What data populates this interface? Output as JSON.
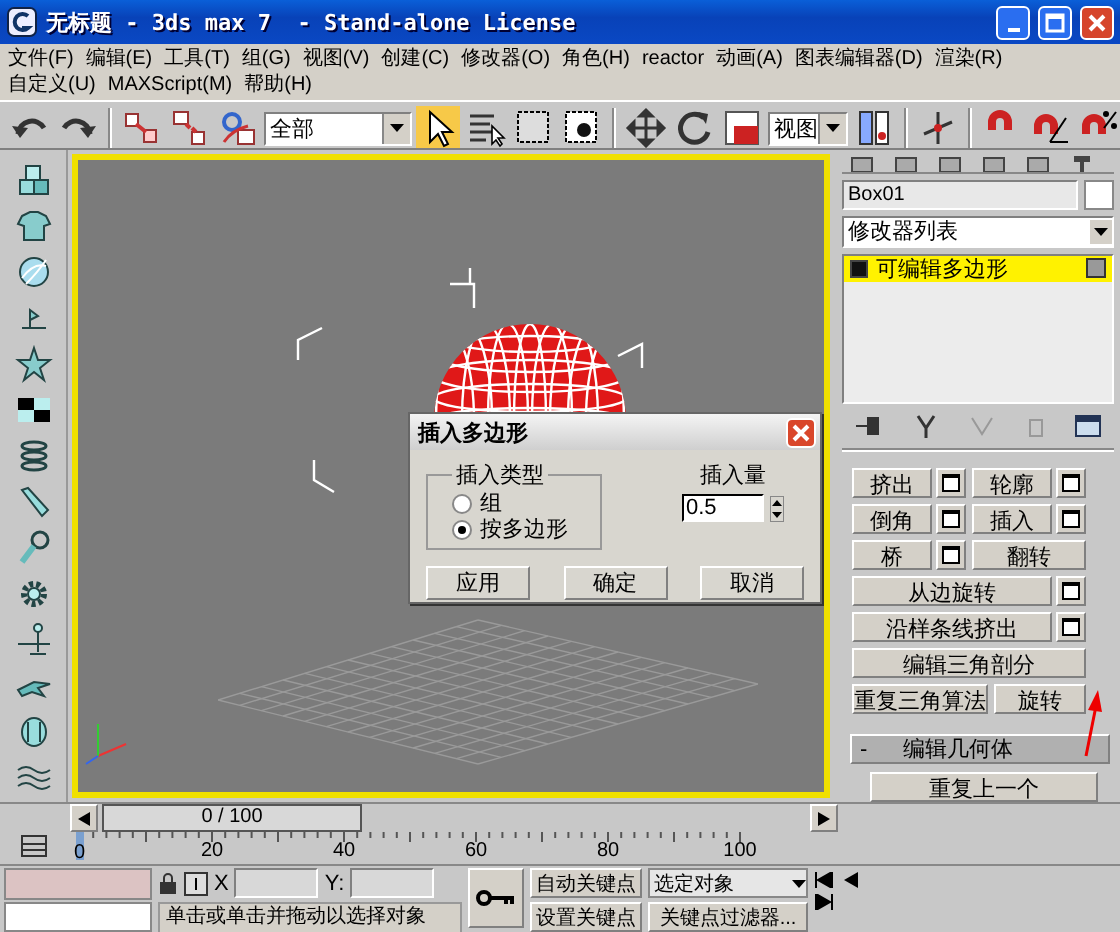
{
  "window": {
    "title": "无标题 - 3ds max 7  - Stand-alone License"
  },
  "menu_rows": [
    [
      "文件(F)",
      "编辑(E)",
      "工具(T)",
      "组(G)",
      "视图(V)",
      "创建(C)",
      "修改器(O)",
      "角色(H)",
      "reactor",
      "动画(A)",
      "图表编辑器(D)",
      "渲染(R)"
    ],
    [
      "自定义(U)",
      "MAXScript(M)",
      "帮助(H)"
    ]
  ],
  "toolbar": {
    "selection_filter": "全部",
    "select_active": true,
    "reference_coords": "视图"
  },
  "viewport": {
    "active": true
  },
  "dialog": {
    "title": "插入多边形",
    "group_label": "插入类型",
    "options": [
      {
        "label": "组",
        "selected": false
      },
      {
        "label": "按多边形",
        "selected": true
      }
    ],
    "amount_label": "插入量",
    "amount_value": "0.5",
    "buttons": [
      "应用",
      "确定",
      "取消"
    ]
  },
  "command_panel": {
    "object_name": "Box01",
    "modifier_list": "修改器列表",
    "stack": [
      {
        "label": "可编辑多边形",
        "selected": true
      }
    ],
    "button_rows": [
      [
        {
          "label": "挤出",
          "settings": true
        },
        {
          "label": "轮廓",
          "settings": true
        }
      ],
      [
        {
          "label": "倒角",
          "settings": true
        },
        {
          "label": "插入",
          "settings": true
        }
      ],
      [
        {
          "label": "桥",
          "settings": true
        },
        {
          "label": "翻转",
          "settings": false
        }
      ],
      [
        {
          "label": "从边旋转",
          "settings": true
        }
      ],
      [
        {
          "label": "沿样条线挤出",
          "settings": true
        }
      ],
      [
        {
          "label": "编辑三角剖分",
          "settings": false
        }
      ],
      [
        {
          "label": "重复三角算法",
          "settings": false
        },
        {
          "label": "旋转",
          "settings": false
        }
      ]
    ],
    "rollout": {
      "toggle": "-",
      "title": "编辑几何体"
    },
    "repeat_button": "重复上一个"
  },
  "timeline": {
    "slider": "0 / 100",
    "ruler_labels": [
      "0",
      "20",
      "40",
      "60",
      "80",
      "100"
    ]
  },
  "status": {
    "x_label": "X",
    "y_label": "Y:",
    "prompt": "单击或单击并拖动以选择对象",
    "auto_key": "自动关键点",
    "set_key": "设置关键点",
    "key_mode": "选定对象",
    "key_filters": "关键点过滤器..."
  }
}
